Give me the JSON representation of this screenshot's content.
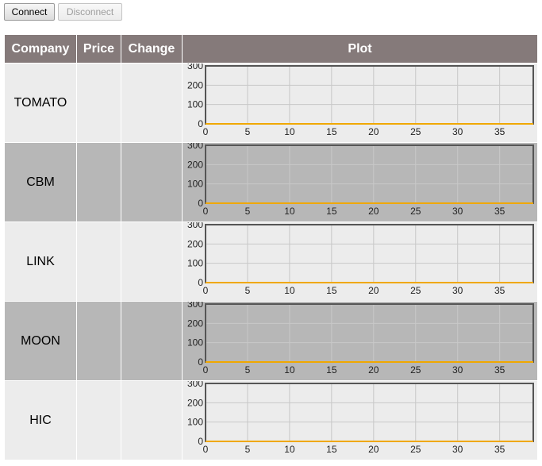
{
  "toolbar": {
    "connect_label": "Connect",
    "disconnect_label": "Disconnect"
  },
  "table": {
    "headers": {
      "company": "Company",
      "price": "Price",
      "change": "Change",
      "plot": "Plot"
    },
    "rows": [
      {
        "company": "TOMATO",
        "price": "",
        "change": ""
      },
      {
        "company": "CBM",
        "price": "",
        "change": ""
      },
      {
        "company": "LINK",
        "price": "",
        "change": ""
      },
      {
        "company": "MOON",
        "price": "",
        "change": ""
      },
      {
        "company": "HIC",
        "price": "",
        "change": ""
      }
    ]
  },
  "colors": {
    "header_bg": "#857a7a",
    "row_light": "#ececec",
    "row_dark": "#b7b7b7",
    "series": "#f0a800",
    "grid": "#c8c8c8",
    "frame": "#555555"
  },
  "chart_data": [
    {
      "type": "line",
      "company": "TOMATO",
      "x_ticks": [
        0,
        5,
        10,
        15,
        20,
        25,
        30,
        35
      ],
      "y_ticks": [
        0,
        100,
        200,
        300
      ],
      "xlim": [
        0,
        39
      ],
      "ylim": [
        0,
        300
      ],
      "grid": true,
      "series": [
        {
          "values": [
            0,
            0,
            0,
            0,
            0,
            0,
            0,
            0,
            0,
            0,
            0,
            0,
            0,
            0,
            0,
            0,
            0,
            0,
            0,
            0,
            0,
            0,
            0,
            0,
            0,
            0,
            0,
            0,
            0,
            0,
            0,
            0,
            0,
            0,
            0,
            0,
            0,
            0,
            0,
            0
          ]
        }
      ]
    },
    {
      "type": "line",
      "company": "CBM",
      "x_ticks": [
        0,
        5,
        10,
        15,
        20,
        25,
        30,
        35
      ],
      "y_ticks": [
        0,
        100,
        200,
        300
      ],
      "xlim": [
        0,
        39
      ],
      "ylim": [
        0,
        300
      ],
      "grid": true,
      "series": [
        {
          "values": [
            0,
            0,
            0,
            0,
            0,
            0,
            0,
            0,
            0,
            0,
            0,
            0,
            0,
            0,
            0,
            0,
            0,
            0,
            0,
            0,
            0,
            0,
            0,
            0,
            0,
            0,
            0,
            0,
            0,
            0,
            0,
            0,
            0,
            0,
            0,
            0,
            0,
            0,
            0,
            0
          ]
        }
      ]
    },
    {
      "type": "line",
      "company": "LINK",
      "x_ticks": [
        0,
        5,
        10,
        15,
        20,
        25,
        30,
        35
      ],
      "y_ticks": [
        0,
        100,
        200,
        300
      ],
      "xlim": [
        0,
        39
      ],
      "ylim": [
        0,
        300
      ],
      "grid": true,
      "series": [
        {
          "values": [
            0,
            0,
            0,
            0,
            0,
            0,
            0,
            0,
            0,
            0,
            0,
            0,
            0,
            0,
            0,
            0,
            0,
            0,
            0,
            0,
            0,
            0,
            0,
            0,
            0,
            0,
            0,
            0,
            0,
            0,
            0,
            0,
            0,
            0,
            0,
            0,
            0,
            0,
            0,
            0
          ]
        }
      ]
    },
    {
      "type": "line",
      "company": "MOON",
      "x_ticks": [
        0,
        5,
        10,
        15,
        20,
        25,
        30,
        35
      ],
      "y_ticks": [
        0,
        100,
        200,
        300
      ],
      "xlim": [
        0,
        39
      ],
      "ylim": [
        0,
        300
      ],
      "grid": true,
      "series": [
        {
          "values": [
            0,
            0,
            0,
            0,
            0,
            0,
            0,
            0,
            0,
            0,
            0,
            0,
            0,
            0,
            0,
            0,
            0,
            0,
            0,
            0,
            0,
            0,
            0,
            0,
            0,
            0,
            0,
            0,
            0,
            0,
            0,
            0,
            0,
            0,
            0,
            0,
            0,
            0,
            0,
            0
          ]
        }
      ]
    },
    {
      "type": "line",
      "company": "HIC",
      "x_ticks": [
        0,
        5,
        10,
        15,
        20,
        25,
        30,
        35
      ],
      "y_ticks": [
        0,
        100,
        200,
        300
      ],
      "xlim": [
        0,
        39
      ],
      "ylim": [
        0,
        300
      ],
      "grid": true,
      "series": [
        {
          "values": [
            0,
            0,
            0,
            0,
            0,
            0,
            0,
            0,
            0,
            0,
            0,
            0,
            0,
            0,
            0,
            0,
            0,
            0,
            0,
            0,
            0,
            0,
            0,
            0,
            0,
            0,
            0,
            0,
            0,
            0,
            0,
            0,
            0,
            0,
            0,
            0,
            0,
            0,
            0,
            0
          ]
        }
      ]
    }
  ]
}
